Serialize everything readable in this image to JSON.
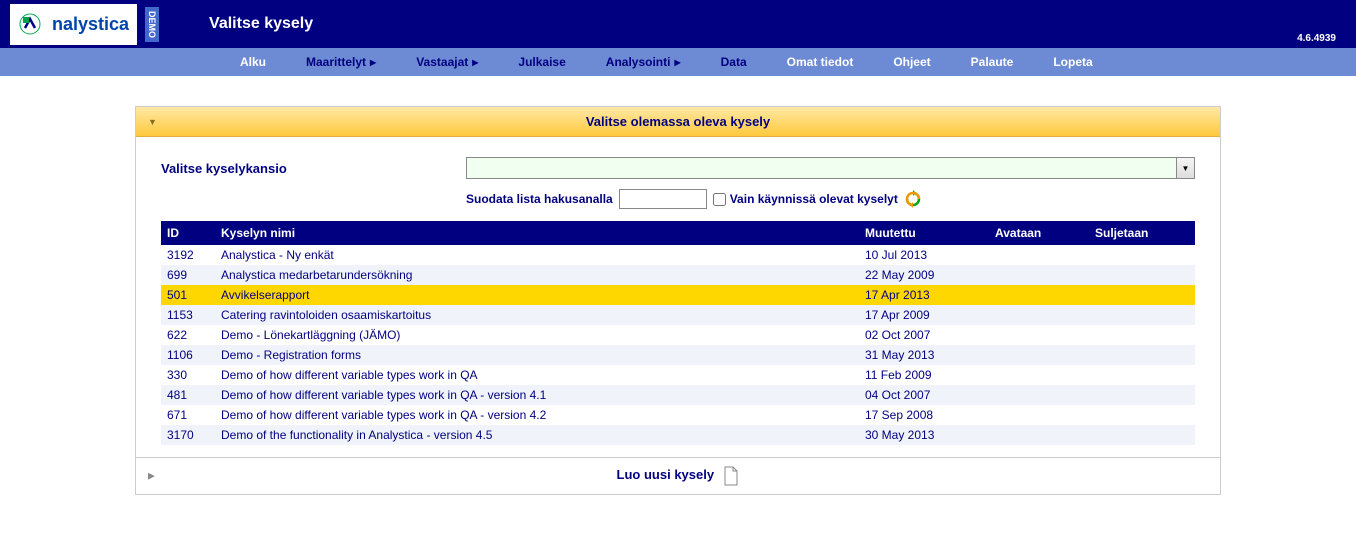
{
  "header": {
    "logo_text": "nalystica",
    "demo_badge": "DEMO",
    "page_title": "Valitse kysely",
    "version": "4.6.4939"
  },
  "nav": {
    "items": [
      {
        "label": "Alku",
        "active": true,
        "arrow": false
      },
      {
        "label": "Maarittelyt",
        "active": false,
        "arrow": true
      },
      {
        "label": "Vastaajat",
        "active": false,
        "arrow": true
      },
      {
        "label": "Julkaise",
        "active": false,
        "arrow": false
      },
      {
        "label": "Analysointi",
        "active": false,
        "arrow": true
      },
      {
        "label": "Data",
        "active": false,
        "arrow": false
      },
      {
        "label": "Omat tiedot",
        "active": false,
        "arrow": false,
        "light": true
      },
      {
        "label": "Ohjeet",
        "active": false,
        "arrow": false,
        "light": true
      },
      {
        "label": "Palaute",
        "active": false,
        "arrow": false,
        "light": true
      },
      {
        "label": "Lopeta",
        "active": false,
        "arrow": false,
        "light": true
      }
    ]
  },
  "panel": {
    "existing_title": "Valitse olemassa oleva kysely",
    "folder_label": "Valitse kyselykansio",
    "filter_label": "Suodata lista hakusanalla",
    "running_only_label": "Vain käynnissä olevat kyselyt",
    "create_title": "Luo uusi kysely"
  },
  "table": {
    "headers": {
      "id": "ID",
      "name": "Kyselyn nimi",
      "modified": "Muutettu",
      "opens": "Avataan",
      "closes": "Suljetaan"
    },
    "rows": [
      {
        "id": "3192",
        "name": "Analystica - Ny enkät",
        "modified": "10 Jul 2013",
        "opens": "",
        "closes": "",
        "selected": false
      },
      {
        "id": "699",
        "name": "Analystica medarbetarundersökning",
        "modified": "22 May 2009",
        "opens": "",
        "closes": "",
        "selected": false
      },
      {
        "id": "501",
        "name": "Avvikelserapport",
        "modified": "17 Apr 2013",
        "opens": "",
        "closes": "",
        "selected": true
      },
      {
        "id": "1153",
        "name": "Catering ravintoloiden osaamiskartoitus",
        "modified": "17 Apr 2009",
        "opens": "",
        "closes": "",
        "selected": false
      },
      {
        "id": "622",
        "name": "Demo - Lönekartläggning (JÄMO)",
        "modified": "02 Oct 2007",
        "opens": "",
        "closes": "",
        "selected": false
      },
      {
        "id": "1106",
        "name": "Demo - Registration forms",
        "modified": "31 May 2013",
        "opens": "",
        "closes": "",
        "selected": false
      },
      {
        "id": "330",
        "name": "Demo of how different variable types work in QA",
        "modified": "11 Feb 2009",
        "opens": "",
        "closes": "",
        "selected": false
      },
      {
        "id": "481",
        "name": "Demo of how different variable types work in QA - version 4.1",
        "modified": "04 Oct 2007",
        "opens": "",
        "closes": "",
        "selected": false
      },
      {
        "id": "671",
        "name": "Demo of how different variable types work in QA - version 4.2",
        "modified": "17 Sep 2008",
        "opens": "",
        "closes": "",
        "selected": false
      },
      {
        "id": "3170",
        "name": "Demo of the functionality in Analystica - version 4.5",
        "modified": "30 May 2013",
        "opens": "",
        "closes": "",
        "selected": false
      }
    ]
  }
}
